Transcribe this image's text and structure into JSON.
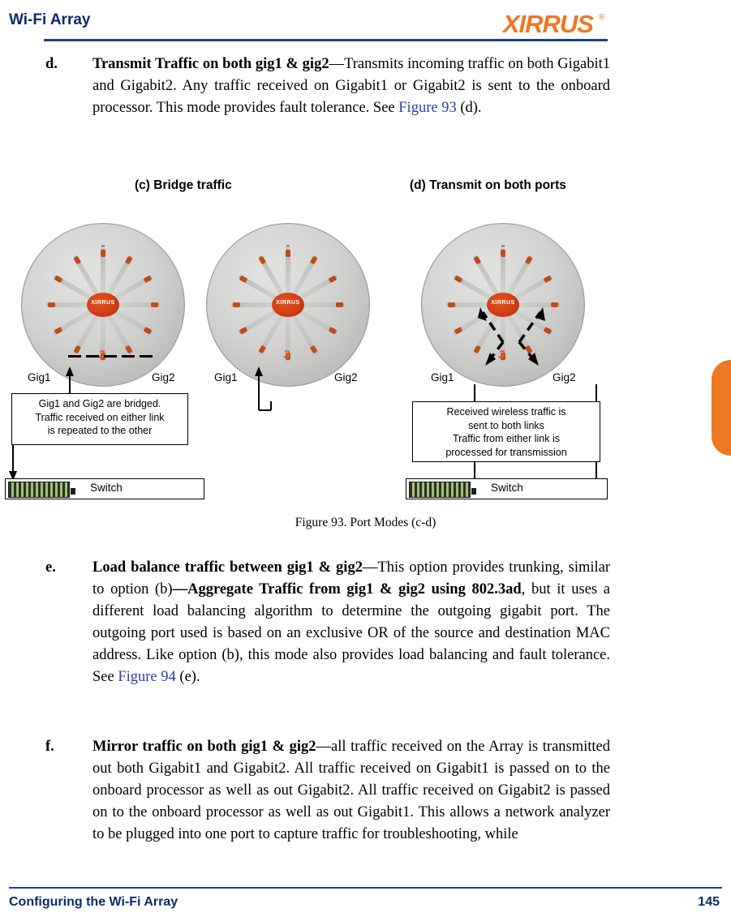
{
  "header": {
    "title": "Wi-Fi Array",
    "logo_text": "XIRRUS",
    "logo_registered": "®"
  },
  "footer": {
    "left": "Configuring the Wi-Fi Array",
    "page_number": "145"
  },
  "paragraphs": [
    {
      "id": "d",
      "marker": "d.",
      "html": "<span class=\"b\">Transmit Traffic on both gig1 &amp; gig2</span>—Transmits incoming traffic on both Gigabit1 and Gigabit2. Any traffic received on Gigabit1 or Gigabit2 is sent to the onboard processor.   This mode provides fault tolerance. See <span class=\"xref\">Figure 93</span> (d)."
    },
    {
      "id": "e",
      "marker": "e.",
      "html": "<span class=\"b\">Load balance traffic between gig1 &amp; gig2</span>—This option provides trunking, similar to option (b)<span class=\"b\">—Aggregate Traffic from gig1 &amp; gig2 using 802.3ad</span>, but it uses a different load balancing algorithm to determine the outgoing gigabit port. The outgoing port used is based on an exclusive OR of the source and destination MAC address. Like option (b), this mode also provides load balancing and fault tolerance. See <span class=\"xref\">Figure 94</span> (e)."
    },
    {
      "id": "f",
      "marker": "f.",
      "html": "<span class=\"b\">Mirror traffic on both gig1 &amp; gig2</span>—all traffic received on the Array is transmitted out both Gigabit1 and Gigabit2.   All traffic received on Gigabit1 is passed on to the onboard processor as well as out Gigabit2. All traffic received on Gigabit2 is passed on to the onboard processor as well as out Gigabit1. This allows a network analyzer to be plugged into one port to capture traffic for troubleshooting, while"
    }
  ],
  "figure": {
    "panel_c_title": "(c) Bridge traffic",
    "panel_d_title": "(d) Transmit on both ports",
    "caption": "Figure 93. Port Modes (c-d)",
    "array_label": "XIRRUS",
    "array_number": "3",
    "ports": {
      "gig1": "Gig1",
      "gig2": "Gig2"
    },
    "switch_label": "Switch",
    "callout_c": "Gig1 and Gig2 are bridged.\nTraffic received on either link\nis repeated to the other",
    "callout_c_lines": [
      "Gig1 and Gig2 are bridged.",
      "Traffic received on either link",
      "is repeated to the other"
    ],
    "callout_d_lines": [
      "Received wireless traffic is",
      "sent to both links",
      "Traffic from either link is",
      "processed for transmission"
    ]
  },
  "colors": {
    "brand_orange": "#ee7722",
    "heading_blue": "#0d2a6b",
    "rule_blue": "#1b3f94",
    "xref_blue": "#2b3faa"
  }
}
